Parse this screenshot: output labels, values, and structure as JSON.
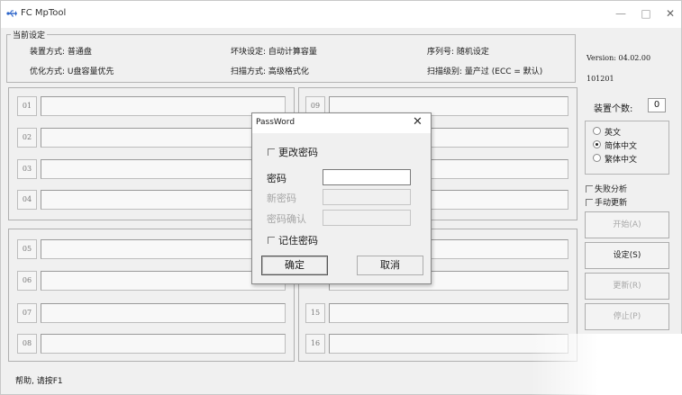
{
  "window": {
    "title": "FC MpTool",
    "controls": [
      "—",
      "□",
      "✕"
    ]
  },
  "settings": {
    "legend": "当前设定",
    "device_mode": "装置方式: 普通盘",
    "bad_block": "坏块设定: 自动计算容量",
    "serial": "序列号: 随机设定",
    "optimize": "优化方式: U盘容量优先",
    "scan_mode": "扫描方式: 高级格式化",
    "scan_level": "扫描级别: 量产过 (ECC = 默认)"
  },
  "slots_left": [
    "01",
    "02",
    "03",
    "04",
    "05",
    "06",
    "07",
    "08"
  ],
  "slots_right": [
    "09",
    "15",
    "16"
  ],
  "side": {
    "version": "Version: 04.02.00",
    "build": "101201",
    "device_count_label": "装置个数:",
    "device_count_value": "0",
    "languages": [
      {
        "label": "英文",
        "selected": false
      },
      {
        "label": "简体中文",
        "selected": true
      },
      {
        "label": "繁体中文",
        "selected": false
      }
    ],
    "fail_analysis": "失败分析",
    "manual_update": "手动更新",
    "buttons": {
      "start": "开始(A)",
      "settings": "设定(S)",
      "update": "更新(R)",
      "stop": "停止(P)"
    }
  },
  "status": "帮助, 请按F1",
  "dialog": {
    "title": "PassWord",
    "change_password": "更改密码",
    "password_label": "密码",
    "password_value": "",
    "new_password_label": "新密码",
    "confirm_password_label": "密码确认",
    "remember_password": "记住密码",
    "ok": "确定",
    "cancel": "取消"
  }
}
